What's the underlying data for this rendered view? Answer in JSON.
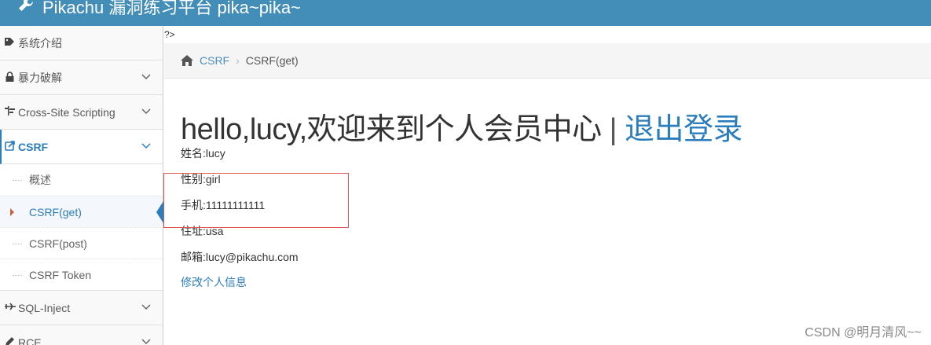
{
  "header": {
    "brand": "Pikachu 漏洞练习平台 pika~pika~",
    "brand_icon": "wrench-icon"
  },
  "sidebar": {
    "items": [
      {
        "label": "系统介绍",
        "icon": "tag-icon",
        "has_chevron": false
      },
      {
        "label": "暴力破解",
        "icon": "lock-icon",
        "has_chevron": true
      },
      {
        "label": "Cross-Site Scripting",
        "icon": "list-icon",
        "has_chevron": true
      },
      {
        "label": "CSRF",
        "icon": "share-icon",
        "has_chevron": true,
        "active": true
      },
      {
        "label": "SQL-Inject",
        "icon": "plane-icon",
        "has_chevron": true
      },
      {
        "label": "RCE",
        "icon": "pencil-icon",
        "has_chevron": true
      }
    ],
    "csrf_submenu": [
      {
        "label": "概述"
      },
      {
        "label": "CSRF(get)",
        "active": true
      },
      {
        "label": "CSRF(post)"
      },
      {
        "label": "CSRF Token"
      }
    ]
  },
  "main": {
    "php_tail": "?>",
    "breadcrumb": {
      "home_icon": "home-icon",
      "link": "CSRF",
      "separator": "›",
      "current": "CSRF(get)"
    },
    "greeting": "hello,lucy,欢迎来到个人会员中心",
    "greeting_separator": "|",
    "logout": "退出登录",
    "profile": {
      "name": "姓名:lucy",
      "gender": "性别:girl",
      "phone": "手机:11111111111",
      "address": "住址:usa",
      "email": "邮箱:lucy@pikachu.com"
    },
    "edit_link": "修改个人信息"
  },
  "annotation": {
    "color": "#e05757"
  },
  "watermark": "CSDN @明月清风~~",
  "colors": {
    "header_bg": "#438eb9",
    "accent": "#2b7dbc"
  }
}
